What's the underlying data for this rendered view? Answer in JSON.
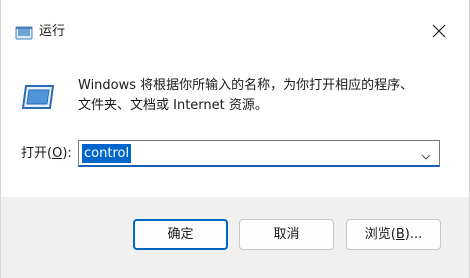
{
  "window": {
    "title": "运行",
    "title_icon": "run-app-icon",
    "close_icon": "close-icon"
  },
  "description": {
    "line1": "Windows 将根据你所输入的名称，为你打开相应的程序、",
    "line2": "文件夹、文档或 Internet 资源。"
  },
  "open": {
    "label_prefix": "打开(",
    "label_accel": "O",
    "label_suffix": "):",
    "value": "control",
    "dropdown_icon": "chevron-down-icon"
  },
  "buttons": {
    "ok": "确定",
    "cancel": "取消",
    "browse_prefix": "浏览(",
    "browse_accel": "B",
    "browse_suffix": ")..."
  },
  "colors": {
    "accent": "#0067c0",
    "selection": "#0066cc",
    "footer_bg": "#f0f0f0"
  }
}
